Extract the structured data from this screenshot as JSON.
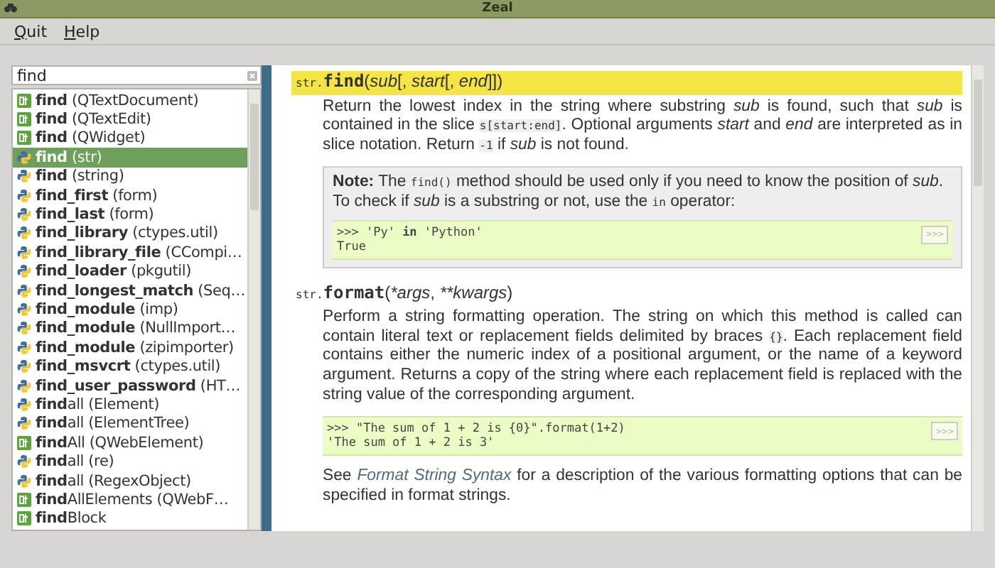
{
  "window": {
    "title": "Zeal"
  },
  "menu": [
    "Quit",
    "Help"
  ],
  "search": {
    "value": "find"
  },
  "results": [
    {
      "kind": "qt",
      "label": "**find** (QTextDocument)",
      "selected": false
    },
    {
      "kind": "qt",
      "label": "**find** (QTextEdit)",
      "selected": false
    },
    {
      "kind": "qt",
      "label": "**find** (QWidget)",
      "selected": false
    },
    {
      "kind": "python",
      "label": "**find** (str)",
      "selected": true
    },
    {
      "kind": "python",
      "label": "**find** (string)",
      "selected": false
    },
    {
      "kind": "python",
      "label": "**find_first** (form)",
      "selected": false
    },
    {
      "kind": "python",
      "label": "**find_last** (form)",
      "selected": false
    },
    {
      "kind": "python",
      "label": "**find_library** (ctypes.util)",
      "selected": false
    },
    {
      "kind": "python",
      "label": "**find_library_file** (CCompi…",
      "selected": false
    },
    {
      "kind": "python",
      "label": "**find_loader** (pkgutil)",
      "selected": false
    },
    {
      "kind": "python",
      "label": "**find_longest_match** (Seq…",
      "selected": false
    },
    {
      "kind": "python",
      "label": "**find_module** (imp)",
      "selected": false
    },
    {
      "kind": "python",
      "label": "**find_module** (NullImport…",
      "selected": false
    },
    {
      "kind": "python",
      "label": "**find_module** (zipimporter)",
      "selected": false
    },
    {
      "kind": "python",
      "label": "**find_msvcrt** (ctypes.util)",
      "selected": false
    },
    {
      "kind": "python",
      "label": "**find_user_password** (HT…",
      "selected": false
    },
    {
      "kind": "python",
      "label": "**find**all (Element)",
      "selected": false
    },
    {
      "kind": "python",
      "label": "**find**all (ElementTree)",
      "selected": false
    },
    {
      "kind": "qt",
      "label": "**find**All (QWebElement)",
      "selected": false
    },
    {
      "kind": "python",
      "label": "**find**all (re)",
      "selected": false
    },
    {
      "kind": "python",
      "label": "**find**all (RegexObject)",
      "selected": false
    },
    {
      "kind": "qt",
      "label": "**find**AllElements (QWebF…",
      "selected": false
    },
    {
      "kind": "qt",
      "label": "**find**Block",
      "selected": false
    }
  ],
  "doc": [
    {
      "kind": "signature",
      "highlighted": true,
      "prefix": "str.",
      "name": "find",
      "args": [
        {
          "kind": "punct",
          "text": "("
        },
        {
          "kind": "param",
          "text": "sub"
        },
        {
          "kind": "punct",
          "text": "[, "
        },
        {
          "kind": "param",
          "text": "start"
        },
        {
          "kind": "punct",
          "text": "[, "
        },
        {
          "kind": "param",
          "text": "end"
        },
        {
          "kind": "punct",
          "text": "]])"
        }
      ]
    },
    {
      "kind": "paragraph",
      "parts": [
        {
          "kind": "text",
          "text": "Return the lowest index in the string where substring *sub* is found, such that *sub* is contained in the slice "
        },
        {
          "kind": "code",
          "text": "s[start:end]"
        },
        {
          "kind": "text",
          "text": ". Optional arguments *start* and *end* are interpreted as in slice notation. Return "
        },
        {
          "kind": "code",
          "text": "-1"
        },
        {
          "kind": "text",
          "text": " if *sub* is not found."
        }
      ]
    },
    {
      "kind": "note",
      "title": "Note:",
      "parts": [
        {
          "kind": "text",
          "text": "The "
        },
        {
          "kind": "code",
          "text": "find()"
        },
        {
          "kind": "text",
          "text": " method should be used only if you need to know the position of *sub*. To check if *sub* is a substring or not, use the "
        },
        {
          "kind": "code",
          "text": "in"
        },
        {
          "kind": "text",
          "text": " operator:"
        }
      ],
      "example": {
        "button": ">>>",
        "lines": [
          ">>> 'Py' **in** 'Python'",
          "True"
        ]
      }
    },
    {
      "kind": "signature",
      "highlighted": false,
      "prefix": "str.",
      "name": "format",
      "args": [
        {
          "kind": "punct",
          "text": "("
        },
        {
          "kind": "param",
          "text": "*args"
        },
        {
          "kind": "punct",
          "text": ", "
        },
        {
          "kind": "param",
          "text": "**kwargs"
        },
        {
          "kind": "punct",
          "text": ")"
        }
      ]
    },
    {
      "kind": "paragraph",
      "parts": [
        {
          "kind": "text",
          "text": "Perform a string formatting operation. The string on which this method is called can contain literal text or replacement fields delimited by braces "
        },
        {
          "kind": "code",
          "text": "{}"
        },
        {
          "kind": "text",
          "text": ". Each replacement field contains either the numeric index of a positional argument, or the name of a keyword argument. Returns a copy of the string where each replacement field is replaced with the string value of the corresponding argument."
        }
      ]
    },
    {
      "kind": "example",
      "button": ">>>",
      "lines": [
        ">>> \"The sum of 1 + 2 is {0}\".format(1+2)",
        "'The sum of 1 + 2 is 3'"
      ]
    },
    {
      "kind": "paragraph",
      "parts": [
        {
          "kind": "text",
          "text": "See "
        },
        {
          "kind": "link",
          "text": "Format String Syntax"
        },
        {
          "kind": "text",
          "text": " for a description of the various formatting options that can be specified in format strings."
        }
      ]
    }
  ]
}
